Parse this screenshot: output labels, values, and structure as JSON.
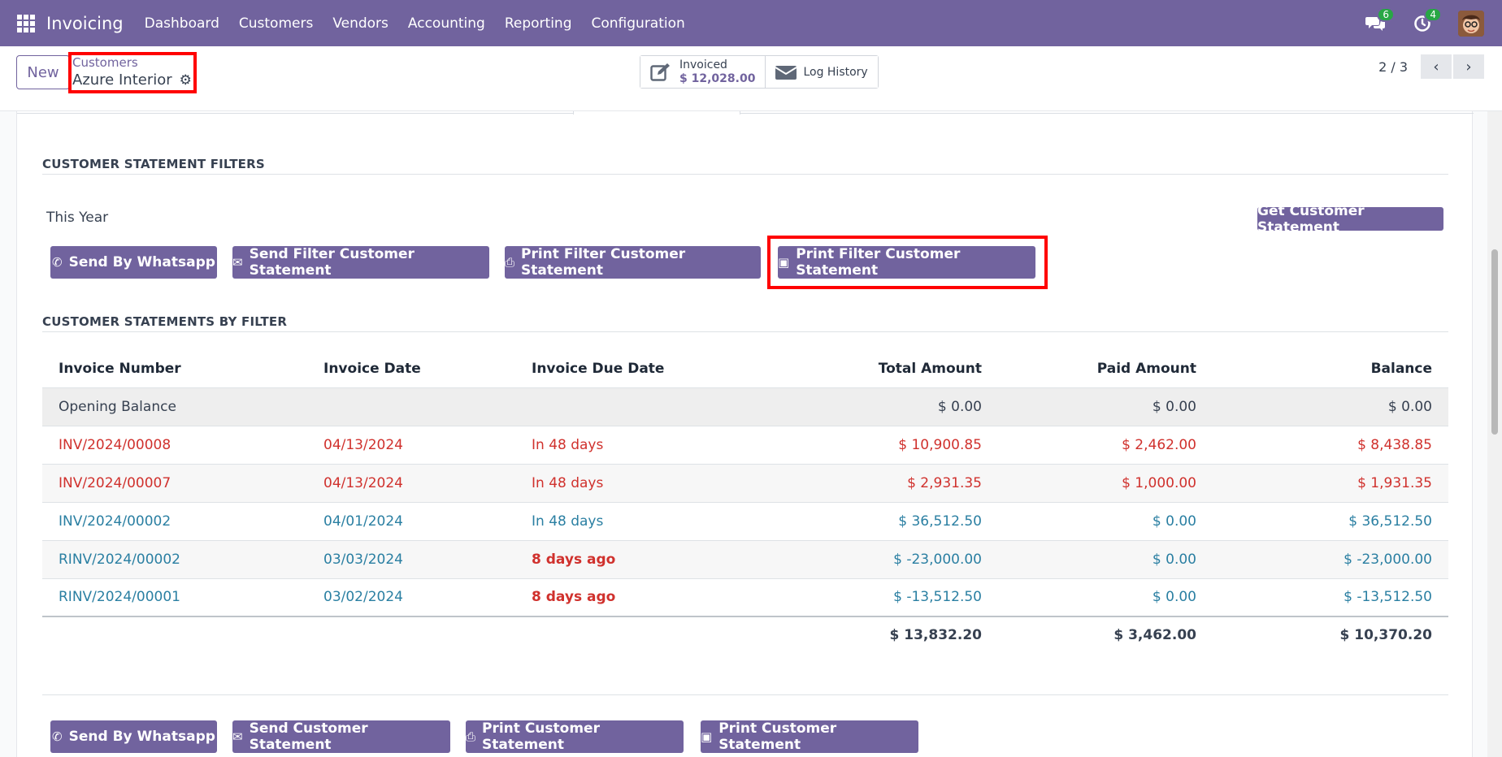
{
  "navbar": {
    "brand": "Invoicing",
    "menu": [
      "Dashboard",
      "Customers",
      "Vendors",
      "Accounting",
      "Reporting",
      "Configuration"
    ],
    "messages_badge": "6",
    "activities_badge": "4"
  },
  "control_panel": {
    "new_label": "New",
    "breadcrumb_parent": "Customers",
    "breadcrumb_current": "Azure Interior",
    "invoiced_label": "Invoiced",
    "invoiced_value": "$ 12,028.00",
    "log_history_label": "Log History",
    "pager_value": "2 / 3"
  },
  "filters_section": {
    "title": "CUSTOMER STATEMENT FILTERS",
    "period": "This Year",
    "get_statement_label": "Get Customer Statement",
    "send_whatsapp_label": "Send By Whatsapp",
    "send_filter_label": "Send Filter Customer Statement",
    "print_filter_pdf_label": "Print Filter Customer Statement",
    "print_filter_xls_label": "Print Filter Customer Statement"
  },
  "table_section": {
    "title": "CUSTOMER STATEMENTS BY FILTER",
    "headers": [
      "Invoice Number",
      "Invoice Date",
      "Invoice Due Date",
      "Total Amount",
      "Paid Amount",
      "Balance"
    ],
    "opening": {
      "label": "Opening Balance",
      "total": "$ 0.00",
      "paid": "$ 0.00",
      "balance": "$ 0.00"
    },
    "rows": [
      {
        "number": "INV/2024/00008",
        "date": "04/13/2024",
        "due": "In 48 days",
        "total": "$ 10,900.85",
        "paid": "$ 2,462.00",
        "balance": "$ 8,438.85"
      },
      {
        "number": "INV/2024/00007",
        "date": "04/13/2024",
        "due": "In 48 days",
        "total": "$ 2,931.35",
        "paid": "$ 1,000.00",
        "balance": "$ 1,931.35"
      },
      {
        "number": "INV/2024/00002",
        "date": "04/01/2024",
        "due": "In 48 days",
        "total": "$ 36,512.50",
        "paid": "$ 0.00",
        "balance": "$ 36,512.50"
      },
      {
        "number": "RINV/2024/00002",
        "date": "03/03/2024",
        "due": "8 days ago",
        "total": "$ -23,000.00",
        "paid": "$ 0.00",
        "balance": "$ -23,000.00"
      },
      {
        "number": "RINV/2024/00001",
        "date": "03/02/2024",
        "due": "8 days ago",
        "total": "$ -13,512.50",
        "paid": "$ 0.00",
        "balance": "$ -13,512.50"
      }
    ],
    "totals": {
      "total": "$ 13,832.20",
      "paid": "$ 3,462.00",
      "balance": "$ 10,370.20"
    }
  },
  "bottom_actions": {
    "send_whatsapp_label": "Send By Whatsapp",
    "send_statement_label": "Send Customer Statement",
    "print_pdf_label": "Print Customer Statement",
    "print_xls_label": "Print Customer Statement"
  },
  "colors": {
    "brand": "#71639e",
    "overdue": "#d0312d",
    "normal": "#2a7fa2",
    "highlight": "#ff0000"
  }
}
